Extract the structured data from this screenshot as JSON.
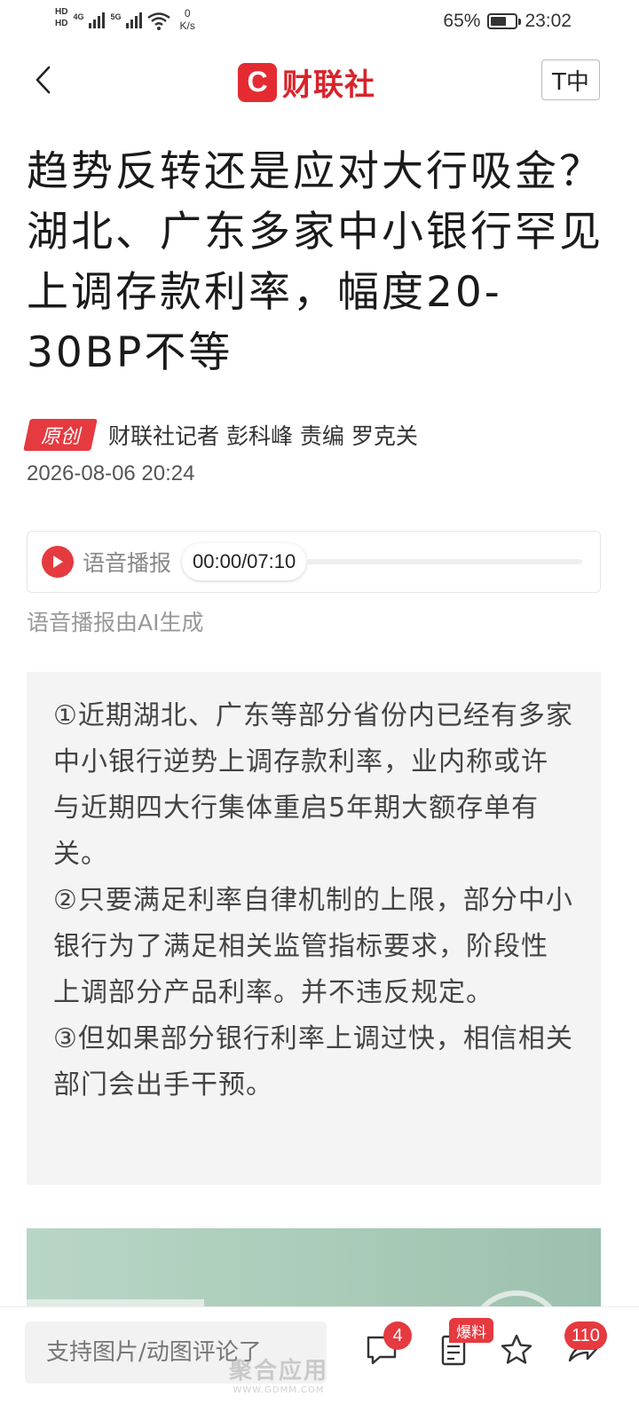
{
  "status_bar": {
    "hd_labels": [
      "HD",
      "HD"
    ],
    "network_1": "4G",
    "network_2": "5G",
    "speed_value": "0",
    "speed_unit": "K/s",
    "battery_percent": "65%",
    "battery_level": 0.65,
    "time": "23:02"
  },
  "header": {
    "brand_mark": "C",
    "brand_name": "财联社",
    "font_size_button": "T中"
  },
  "article": {
    "title": "趋势反转还是应对大行吸金？湖北、广东多家中小银行罕见上调存款利率，幅度20-30BP不等",
    "original_badge": "原创",
    "author_line": "财联社记者 彭科峰  责编 罗克关",
    "publish_time": "2026-08-06 20:24"
  },
  "audio": {
    "label": "语音播报",
    "time": "00:00/07:10",
    "progress": 0,
    "note": "语音播报由AI生成"
  },
  "summary": {
    "items": [
      "①近期湖北、广东等部分省份内已经有多家中小银行逆势上调存款利率，业内称或许与近期四大行集体重启5年期大额存单有关。",
      "②只要满足利率自律机制的上限，部分中小银行为了满足相关监管指标要求，阶段性上调部分产品利率。并不违反规定。",
      "③但如果部分银行利率上调过快，相信相关部门会出手干预。"
    ]
  },
  "bottom_bar": {
    "comment_placeholder": "支持图片/动图评论了",
    "comment_count": "4",
    "baoliao_label": "爆料",
    "share_count": "110"
  },
  "watermark": {
    "text": "聚合应用",
    "url": "WWW.GDMM.COM"
  },
  "colors": {
    "brand_red": "#e42b32",
    "accent_red": "#e53a3f",
    "summary_bg": "#f4f4f4"
  }
}
